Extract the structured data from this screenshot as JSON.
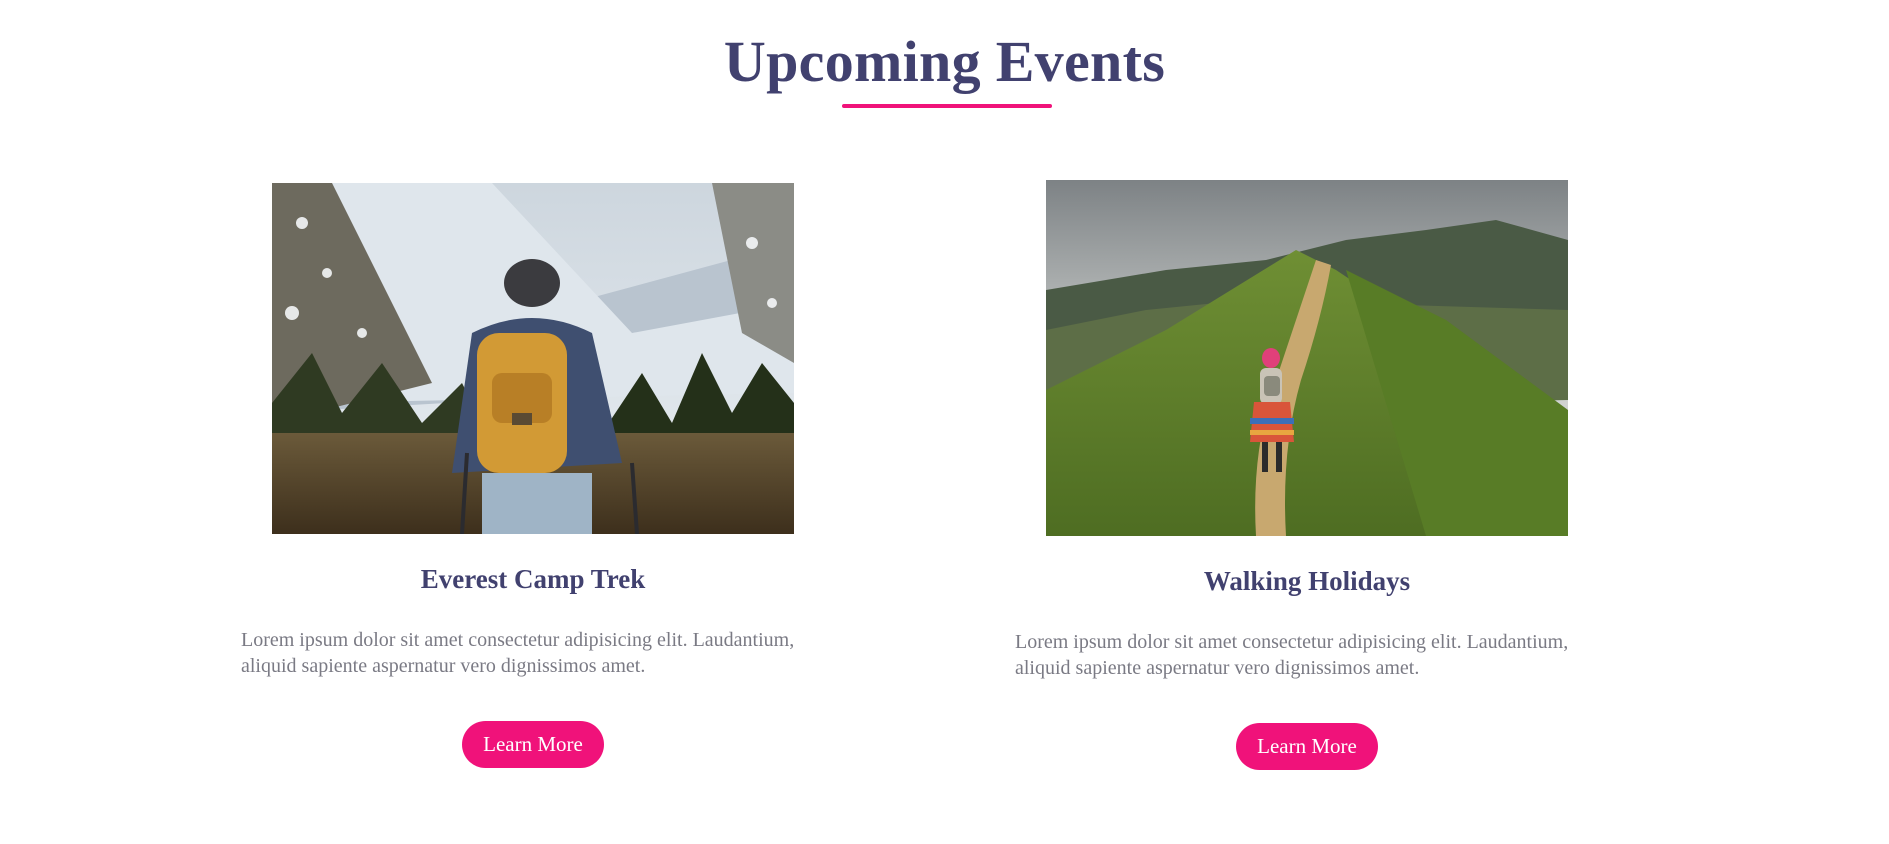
{
  "section": {
    "title": "Upcoming Events"
  },
  "colors": {
    "heading": "#41416f",
    "accent": "#f0127a",
    "body_text": "#7a7a84",
    "button_text": "#ffffff",
    "background": "#ffffff"
  },
  "events": [
    {
      "image_subject": "hiker with yellow backpack facing snowy mountains",
      "title": "Everest Camp Trek",
      "description": "Lorem ipsum dolor sit amet consectetur adipisicing elit. Laudantium, aliquid sapiente aspernatur vero dignissimos amet.",
      "button_label": "Learn More"
    },
    {
      "image_subject": "woman walking along a green mountain ridge trail",
      "title": "Walking Holidays",
      "description": "Lorem ipsum dolor sit amet consectetur adipisicing elit. Laudantium, aliquid sapiente aspernatur vero dignissimos amet.",
      "button_label": "Learn More"
    }
  ]
}
